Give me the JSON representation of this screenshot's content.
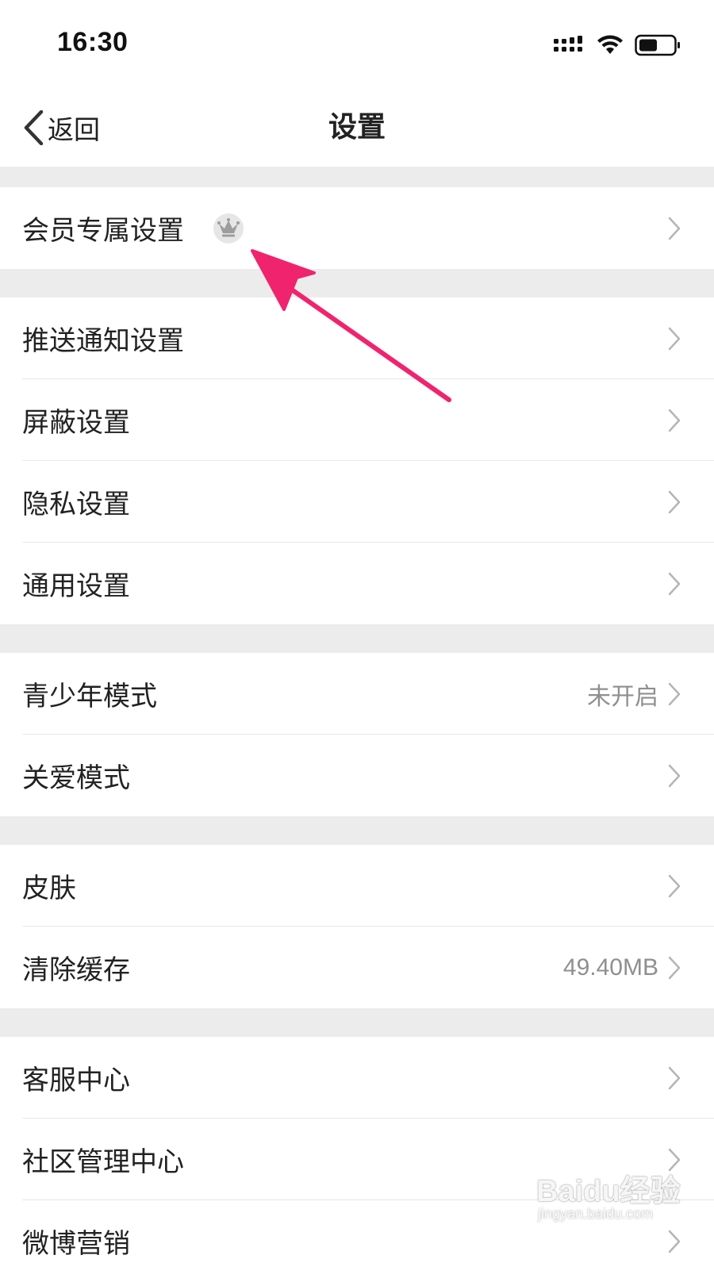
{
  "status_bar": {
    "time": "16:30",
    "icons": [
      "signal-icon",
      "wifi-icon",
      "battery-icon"
    ]
  },
  "nav": {
    "back_label": "返回",
    "title": "设置"
  },
  "sections": [
    {
      "rows": [
        {
          "label": "会员专属设置",
          "value": "",
          "badge": "crown-icon"
        }
      ]
    },
    {
      "rows": [
        {
          "label": "推送通知设置",
          "value": ""
        },
        {
          "label": "屏蔽设置",
          "value": ""
        },
        {
          "label": "隐私设置",
          "value": ""
        },
        {
          "label": "通用设置",
          "value": ""
        }
      ]
    },
    {
      "rows": [
        {
          "label": "青少年模式",
          "value": "未开启"
        },
        {
          "label": "关爱模式",
          "value": ""
        }
      ]
    },
    {
      "rows": [
        {
          "label": "皮肤",
          "value": ""
        },
        {
          "label": "清除缓存",
          "value": "49.40MB"
        }
      ]
    },
    {
      "rows": [
        {
          "label": "客服中心",
          "value": ""
        },
        {
          "label": "社区管理中心",
          "value": ""
        },
        {
          "label": "微博营销",
          "value": ""
        }
      ]
    }
  ],
  "annotation": {
    "color": "#f0246e",
    "icon": "arrow-icon"
  },
  "watermark": {
    "brand": "Baidu经验",
    "url": "jingyan.baidu.com"
  },
  "colors": {
    "background": "#ffffff",
    "section_gap": "#ececec",
    "text": "#222222",
    "secondary_text": "#8f8f8f",
    "chevron": "#b5b5b5"
  }
}
